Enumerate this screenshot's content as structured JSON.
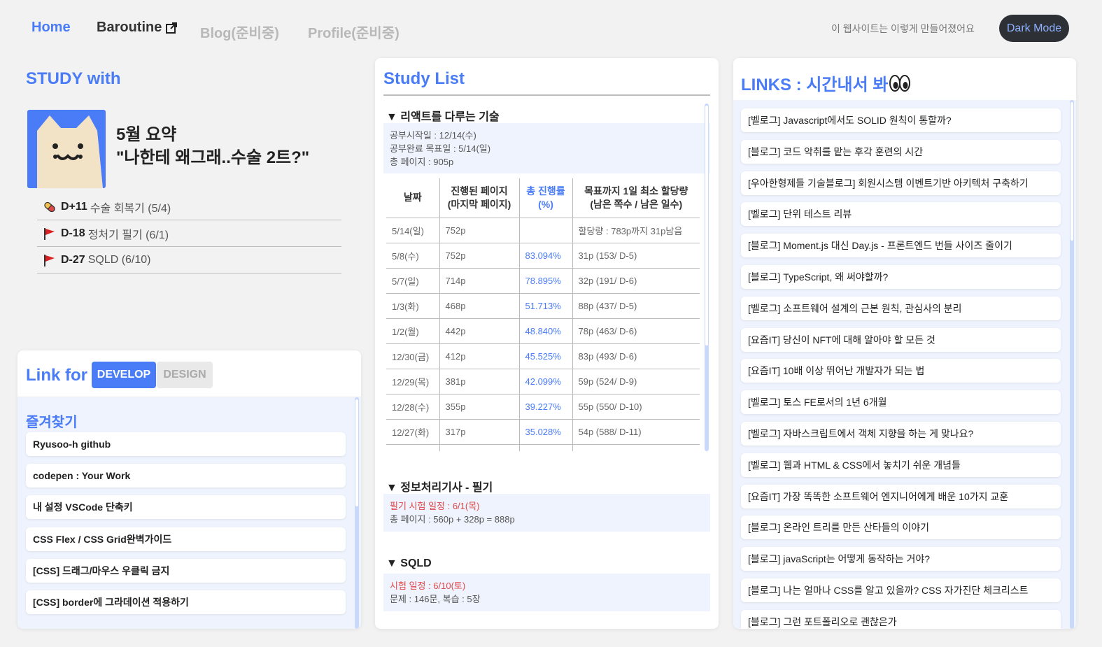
{
  "nav": {
    "home": "Home",
    "baroutine": "Baroutine",
    "blog": "Blog(준비중)",
    "profile": "Profile(준비중)",
    "made": "이 웹사이트는 이렇게 만들어졌어요",
    "dark_mode": "Dark Mode"
  },
  "study": {
    "title": "STUDY with",
    "summary_line1": "5월 요약",
    "summary_line2": "\"나한테 왜그래..수술 2트?\"",
    "ddays": [
      {
        "code": "D+11",
        "text": "수술 회복기 (5/4)",
        "icon": "pill-icon"
      },
      {
        "code": "D-18",
        "text": "정처기 필기 (6/1)",
        "icon": "flag-icon"
      },
      {
        "code": "D-27",
        "text": "SQLD (6/10)",
        "icon": "flag-icon"
      }
    ]
  },
  "linkfor": {
    "title": "Link for",
    "tab_develop": "DEVELOP",
    "tab_design": "DESIGN",
    "fav_title": "즐겨찾기",
    "items": [
      "Ryusoo-h github",
      "codepen : Your Work",
      "내 설정 VSCode 단축키",
      "CSS Flex / CSS Grid완벽가이드",
      "[CSS] 드래그/마우스 우클릭 금지",
      "[CSS] border에 그라데이션 적용하기"
    ]
  },
  "studylist": {
    "title": "Study List",
    "react": {
      "head": "▼ 리액트를 다루는 기술",
      "start": "공부시작일 : 12/14(수)",
      "goal": "공부완료 목표일 : 5/14(일)",
      "pages": "총 페이지 : 905p",
      "headers": [
        "날짜",
        "진행된 페이지\n(마지막 페이지)",
        "총 진행률\n(%)",
        "목표까지 1일 최소 할당량\n(남은 쪽수 / 남은 일수)"
      ],
      "rows": [
        [
          "5/14(일)",
          "752p",
          "",
          "할당량 : 783p까지 31p남음"
        ],
        [
          "5/8(수)",
          "752p",
          "83.094%",
          "31p (153/ D-5)"
        ],
        [
          "5/7(일)",
          "714p",
          "78.895%",
          "32p (191/ D-6)"
        ],
        [
          "1/3(화)",
          "468p",
          "51.713%",
          "88p (437/ D-5)"
        ],
        [
          "1/2(월)",
          "442p",
          "48.840%",
          "78p (463/ D-6)"
        ],
        [
          "12/30(금)",
          "412p",
          "45.525%",
          "83p (493/ D-6)"
        ],
        [
          "12/29(목)",
          "381p",
          "42.099%",
          "59p (524/ D-9)"
        ],
        [
          "12/28(수)",
          "355p",
          "39.227%",
          "55p (550/ D-10)"
        ],
        [
          "12/27(화)",
          "317p",
          "35.028%",
          "54p (588/ D-11)"
        ]
      ]
    },
    "jeongcheogi": {
      "head": "▼ 정보처리기사 - 필기",
      "exam": "필기 시험 일정 : 6/1(목)",
      "pages": "총 페이지 : 560p + 328p = 888p"
    },
    "sqld": {
      "head": "▼ SQLD",
      "exam": "시험 일정 : 6/10(토)",
      "problems": "문제 : 146문, 복습 : 5장"
    }
  },
  "links": {
    "title": "LINKS : 시간내서 봐",
    "items": [
      "[벨로그] Javascript에서도 SOLID 원칙이 통할까?",
      "[블로그] 코드 악취를 맡는 후각 훈련의 시간",
      "[우아한형제들 기술블로그] 회원시스템 이벤트기반 아키텍처 구축하기",
      "[벨로그] 단위 테스트 리뷰",
      "[블로그] Moment.js 대신 Day.js - 프론트엔드 번들 사이즈 줄이기",
      "[블로그] TypeScript, 왜 써야할까?",
      "[벨로그] 소프트웨어 설계의 근본 원칙, 관심사의 분리",
      "[요즘IT] 당신이 NFT에 대해 알아야 할 모든 것",
      "[요즘IT] 10배 이상 뛰어난 개발자가 되는 법",
      "[벨로그] 토스 FE로서의 1년 6개월",
      "[벨로그] 자바스크립트에서 객체 지향을 하는 게 맞나요?",
      "[벨로그] 웹과 HTML & CSS에서 놓치기 쉬운 개념들",
      "[요즘IT] 가장 똑똑한 소프트웨어 엔지니어에게 배운 10가지 교훈",
      "[블로그] 온라인 트리를 만든 산타들의 이야기",
      "[블로그] javaScript는 어떻게 동작하는 거야?",
      "[블로그] 나는 얼마나 CSS를 알고 있을까? CSS 자가진단 체크리스트",
      "[블로그] 그런 포트폴리오로 괜찮은가"
    ]
  },
  "colors": {
    "accent": "#4a7cf7",
    "dark_button": "#2d3035",
    "light_panel": "#eef3fd",
    "red_text": "#e04848"
  }
}
